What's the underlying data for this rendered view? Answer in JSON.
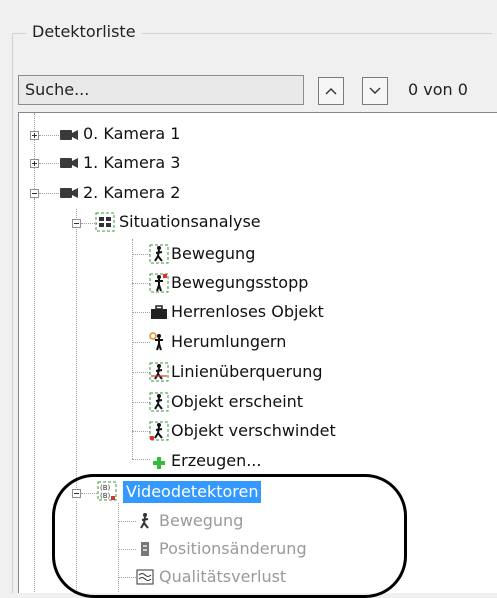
{
  "group": {
    "title": "Detektorliste"
  },
  "search": {
    "value": "Suche...",
    "counter": "0 von 0"
  },
  "tree": [
    {
      "id": "cam0",
      "label": "0. Kamera 1",
      "state": "collapsed"
    },
    {
      "id": "cam1",
      "label": "1. Kamera 3",
      "state": "collapsed"
    },
    {
      "id": "cam2",
      "label": "2. Kamera 2",
      "state": "expanded"
    },
    {
      "id": "situationsanalyse",
      "label": "Situationsanalyse",
      "state": "expanded"
    },
    {
      "id": "bewegung",
      "label": "Bewegung"
    },
    {
      "id": "bewegungsstopp",
      "label": "Bewegungsstopp"
    },
    {
      "id": "herrenloses",
      "label": "Herrenloses Objekt"
    },
    {
      "id": "herumlungern",
      "label": "Herumlungern"
    },
    {
      "id": "linien",
      "label": "Linienüberquerung"
    },
    {
      "id": "erscheint",
      "label": "Objekt erscheint"
    },
    {
      "id": "verschwindet",
      "label": "Objekt verschwindet"
    },
    {
      "id": "erzeugen",
      "label": "Erzeugen..."
    },
    {
      "id": "videodetektoren",
      "label": "Videodetektoren",
      "state": "expanded",
      "selected": true
    },
    {
      "id": "vd-bewegung",
      "label": "Bewegung",
      "disabled": true
    },
    {
      "id": "vd-position",
      "label": "Positionsänderung",
      "disabled": true
    },
    {
      "id": "vd-qualitaet",
      "label": "Qualitätsverlust",
      "disabled": true
    }
  ],
  "icons": {
    "camera": "camera-icon",
    "group": "detector-group-icon",
    "walker": "walking-person-icon",
    "standing": "standing-person-icon",
    "bag": "briefcase-icon",
    "add": "plus-icon",
    "video": "video-detector-group-icon",
    "position": "position-icon",
    "quality": "quality-icon"
  },
  "colors": {
    "selection": "#3399ff",
    "highlight_outline": "#000000"
  }
}
